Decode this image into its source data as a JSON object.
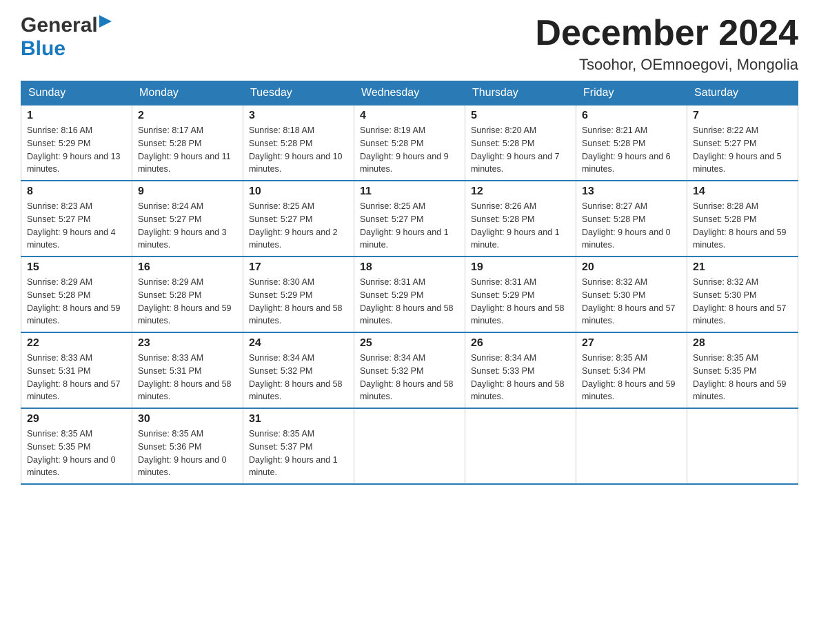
{
  "header": {
    "logo_general": "General",
    "logo_blue": "Blue",
    "title": "December 2024",
    "subtitle": "Tsoohor, OEmnoegovi, Mongolia"
  },
  "weekdays": [
    "Sunday",
    "Monday",
    "Tuesday",
    "Wednesday",
    "Thursday",
    "Friday",
    "Saturday"
  ],
  "weeks": [
    [
      {
        "day": "1",
        "sunrise": "8:16 AM",
        "sunset": "5:29 PM",
        "daylight": "9 hours and 13 minutes."
      },
      {
        "day": "2",
        "sunrise": "8:17 AM",
        "sunset": "5:28 PM",
        "daylight": "9 hours and 11 minutes."
      },
      {
        "day": "3",
        "sunrise": "8:18 AM",
        "sunset": "5:28 PM",
        "daylight": "9 hours and 10 minutes."
      },
      {
        "day": "4",
        "sunrise": "8:19 AM",
        "sunset": "5:28 PM",
        "daylight": "9 hours and 9 minutes."
      },
      {
        "day": "5",
        "sunrise": "8:20 AM",
        "sunset": "5:28 PM",
        "daylight": "9 hours and 7 minutes."
      },
      {
        "day": "6",
        "sunrise": "8:21 AM",
        "sunset": "5:28 PM",
        "daylight": "9 hours and 6 minutes."
      },
      {
        "day": "7",
        "sunrise": "8:22 AM",
        "sunset": "5:27 PM",
        "daylight": "9 hours and 5 minutes."
      }
    ],
    [
      {
        "day": "8",
        "sunrise": "8:23 AM",
        "sunset": "5:27 PM",
        "daylight": "9 hours and 4 minutes."
      },
      {
        "day": "9",
        "sunrise": "8:24 AM",
        "sunset": "5:27 PM",
        "daylight": "9 hours and 3 minutes."
      },
      {
        "day": "10",
        "sunrise": "8:25 AM",
        "sunset": "5:27 PM",
        "daylight": "9 hours and 2 minutes."
      },
      {
        "day": "11",
        "sunrise": "8:25 AM",
        "sunset": "5:27 PM",
        "daylight": "9 hours and 1 minute."
      },
      {
        "day": "12",
        "sunrise": "8:26 AM",
        "sunset": "5:28 PM",
        "daylight": "9 hours and 1 minute."
      },
      {
        "day": "13",
        "sunrise": "8:27 AM",
        "sunset": "5:28 PM",
        "daylight": "9 hours and 0 minutes."
      },
      {
        "day": "14",
        "sunrise": "8:28 AM",
        "sunset": "5:28 PM",
        "daylight": "8 hours and 59 minutes."
      }
    ],
    [
      {
        "day": "15",
        "sunrise": "8:29 AM",
        "sunset": "5:28 PM",
        "daylight": "8 hours and 59 minutes."
      },
      {
        "day": "16",
        "sunrise": "8:29 AM",
        "sunset": "5:28 PM",
        "daylight": "8 hours and 59 minutes."
      },
      {
        "day": "17",
        "sunrise": "8:30 AM",
        "sunset": "5:29 PM",
        "daylight": "8 hours and 58 minutes."
      },
      {
        "day": "18",
        "sunrise": "8:31 AM",
        "sunset": "5:29 PM",
        "daylight": "8 hours and 58 minutes."
      },
      {
        "day": "19",
        "sunrise": "8:31 AM",
        "sunset": "5:29 PM",
        "daylight": "8 hours and 58 minutes."
      },
      {
        "day": "20",
        "sunrise": "8:32 AM",
        "sunset": "5:30 PM",
        "daylight": "8 hours and 57 minutes."
      },
      {
        "day": "21",
        "sunrise": "8:32 AM",
        "sunset": "5:30 PM",
        "daylight": "8 hours and 57 minutes."
      }
    ],
    [
      {
        "day": "22",
        "sunrise": "8:33 AM",
        "sunset": "5:31 PM",
        "daylight": "8 hours and 57 minutes."
      },
      {
        "day": "23",
        "sunrise": "8:33 AM",
        "sunset": "5:31 PM",
        "daylight": "8 hours and 58 minutes."
      },
      {
        "day": "24",
        "sunrise": "8:34 AM",
        "sunset": "5:32 PM",
        "daylight": "8 hours and 58 minutes."
      },
      {
        "day": "25",
        "sunrise": "8:34 AM",
        "sunset": "5:32 PM",
        "daylight": "8 hours and 58 minutes."
      },
      {
        "day": "26",
        "sunrise": "8:34 AM",
        "sunset": "5:33 PM",
        "daylight": "8 hours and 58 minutes."
      },
      {
        "day": "27",
        "sunrise": "8:35 AM",
        "sunset": "5:34 PM",
        "daylight": "8 hours and 59 minutes."
      },
      {
        "day": "28",
        "sunrise": "8:35 AM",
        "sunset": "5:35 PM",
        "daylight": "8 hours and 59 minutes."
      }
    ],
    [
      {
        "day": "29",
        "sunrise": "8:35 AM",
        "sunset": "5:35 PM",
        "daylight": "9 hours and 0 minutes."
      },
      {
        "day": "30",
        "sunrise": "8:35 AM",
        "sunset": "5:36 PM",
        "daylight": "9 hours and 0 minutes."
      },
      {
        "day": "31",
        "sunrise": "8:35 AM",
        "sunset": "5:37 PM",
        "daylight": "9 hours and 1 minute."
      },
      null,
      null,
      null,
      null
    ]
  ]
}
